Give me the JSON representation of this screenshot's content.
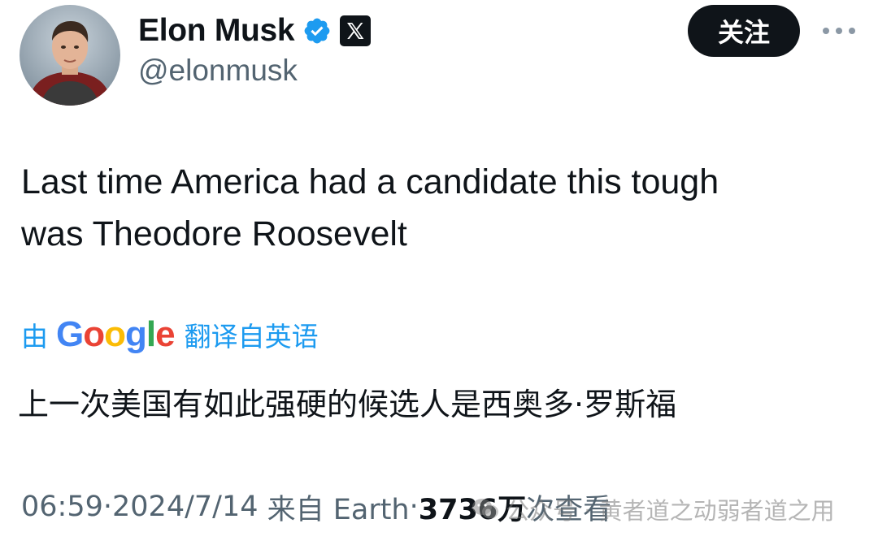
{
  "author": {
    "display_name": "Elon Musk",
    "handle": "@elonmusk",
    "avatar_icon": "profile-photo",
    "verified_icon": "verified-badge-icon",
    "affiliate_icon": "x-logo-icon"
  },
  "actions": {
    "follow_label": "关注",
    "more_icon": "more-dots-icon"
  },
  "tweet": {
    "text_line1": "Last time America had a candidate this tough",
    "text_line2": "was Theodore Roosevelt"
  },
  "translation": {
    "prefix": "由",
    "provider_letters": [
      "G",
      "o",
      "o",
      "g",
      "l",
      "e"
    ],
    "suffix": "翻译自英语",
    "text": "上一次美国有如此强硬的候选人是西奥多·罗斯福"
  },
  "meta": {
    "time": "06:59",
    "separator": " · ",
    "date": "2024/7/14",
    "source": "来自 Earth",
    "views_count": "3736万",
    "views_label": "次查看"
  },
  "watermark": {
    "text": "公众号 · 黄者道之动弱者道之用"
  },
  "colors": {
    "accent": "#1d9bf0",
    "text_primary": "#0f1419",
    "text_secondary": "#536471",
    "google_blue": "#4285F4",
    "google_red": "#EA4335",
    "google_yellow": "#FBBC05",
    "google_green": "#34A853"
  }
}
